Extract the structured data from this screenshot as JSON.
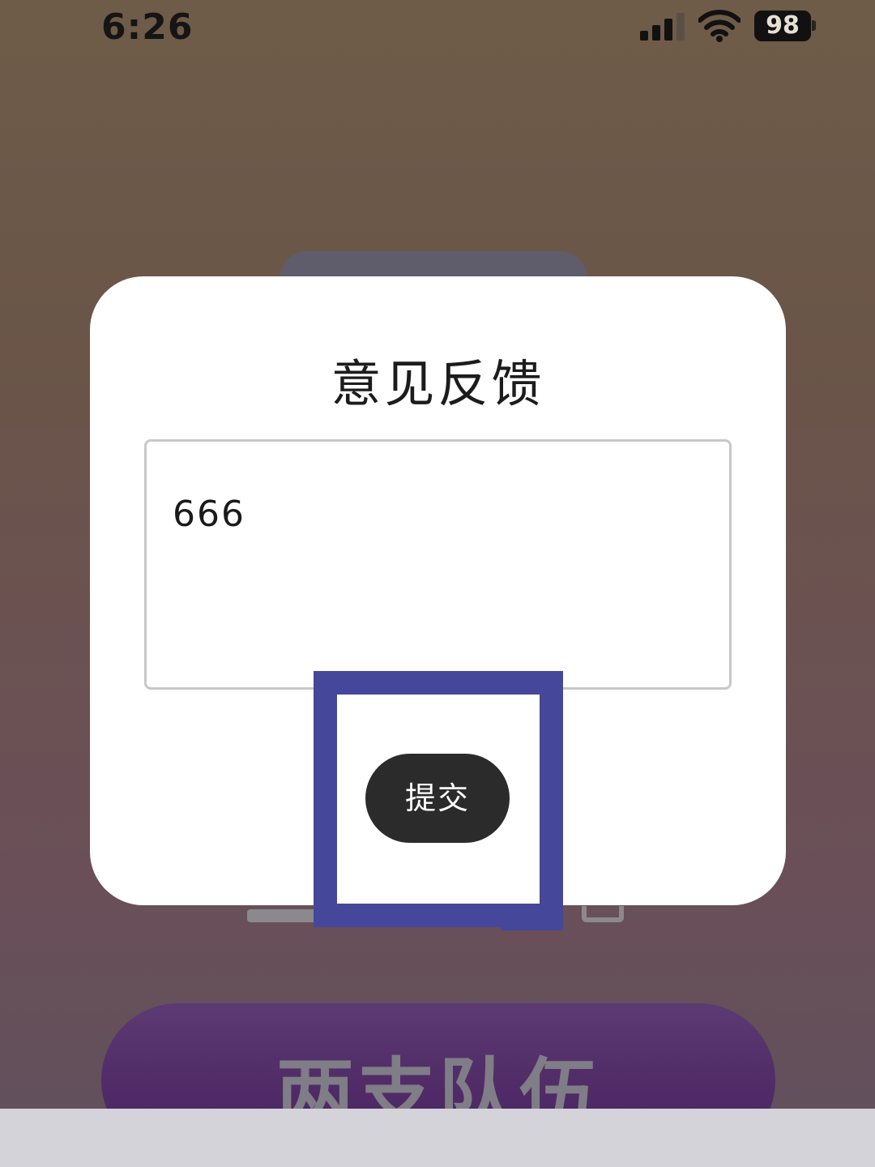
{
  "status_bar": {
    "time": "6:26",
    "battery": "98",
    "icons": [
      "cellular-signal-icon",
      "wifi-icon",
      "battery-icon"
    ]
  },
  "background": {
    "main_button_label": "两支队伍",
    "main_button_color": "#4f2a66"
  },
  "dialog": {
    "title": "意见反馈",
    "feedback_value": "666",
    "submit_label": "提交"
  },
  "annotation": {
    "highlight_color": "#45479a"
  }
}
